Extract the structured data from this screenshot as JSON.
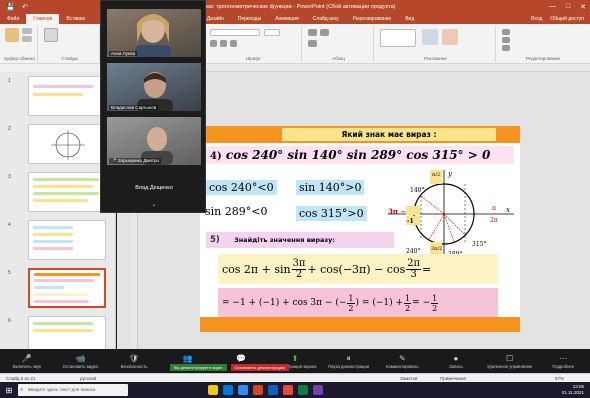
{
  "window": {
    "title": "Тема: тригонометрические функции - PowerPoint (Сбой активации продукта)",
    "controls": [
      "—",
      "□",
      "✕"
    ]
  },
  "ribbon": {
    "tabs": [
      "Файл",
      "Главная",
      "Вставка",
      "Дизайн",
      "Переходы",
      "Анимация",
      "Слайд-шоу",
      "Рецензирование",
      "Вид",
      "Справка"
    ],
    "active_tab": "Главная",
    "right_tools": [
      "Вход",
      "Общий доступ"
    ],
    "groups": [
      "Буфер обмена",
      "Слайды",
      "Шрифт",
      "Абзац",
      "Рисование",
      "Редактирование"
    ]
  },
  "thumbnails": [
    {
      "num": "1"
    },
    {
      "num": "2"
    },
    {
      "num": "3"
    },
    {
      "num": "4"
    },
    {
      "num": "5"
    },
    {
      "num": "6"
    }
  ],
  "zoom": {
    "participants": [
      {
        "name": "Анна Луева",
        "mic": ""
      },
      {
        "name": "Владислав Сартынов",
        "mic": ""
      },
      {
        "name": "Зорыщенко Дмитро",
        "mic": "🎤"
      }
    ],
    "placeholder": "Влад Дещенко",
    "chevron": "⌄",
    "toolbar": [
      {
        "icon": "🎤",
        "label": "Включить звук"
      },
      {
        "icon": "📹",
        "label": "Остановить видео"
      },
      {
        "icon": "🛡",
        "label": "Безопасность"
      },
      {
        "icon": "👥",
        "label": "Участники"
      },
      {
        "icon": "💬",
        "label": "Чат"
      },
      {
        "icon": "⬆",
        "label": "Демонстрация экрана"
      },
      {
        "icon": "⏸",
        "label": "Пауза демонстрации"
      },
      {
        "icon": "✎",
        "label": "Комментировать"
      },
      {
        "icon": "●",
        "label": "Запись"
      },
      {
        "icon": "☐",
        "label": "Удаленное управление"
      },
      {
        "icon": "⋯",
        "label": "Подробнее"
      }
    ],
    "notice_share": "Вы демонстрируете экран",
    "notice_stop": "Остановить демонстрацию"
  },
  "slide": {
    "header": "Який знак має вираз :",
    "task4": {
      "num": "4)",
      "expr": "cos 240° sin 140° sin 289° cos 315° > 0"
    },
    "ineqs": [
      "cos 240°<0",
      "sin 140°>0",
      "sin 289°<0",
      "cos 315°>0"
    ],
    "task5": {
      "num": "5)",
      "text": "Знайдіть значення виразу:"
    },
    "formula1": {
      "a": "cos 2π + sin",
      "frac1_num": "3π",
      "frac1_den": "2",
      "b": "+ cos(−3π) − cos",
      "frac2_num": "2π",
      "frac2_den": "3",
      "c": "="
    },
    "formula2": {
      "a": "= −1 + (−1) + cos 3π − (−",
      "h_num": "1",
      "h_den": "2",
      "b": ") = (−1) +",
      "h2_num": "1",
      "h2_den": "2",
      "c": "= −",
      "h3_num": "1",
      "h3_den": "2"
    },
    "circle_labels": {
      "pi2": "π/2",
      "y": "y",
      "x": "x",
      "a140": "140°",
      "a240": "240°",
      "a289": "289°",
      "a315": "315°",
      "pi": "3π −",
      "m1": "-1",
      "three_pi_2": "3π/2",
      "pi_a": "π",
      "pi_b": "2π"
    }
  },
  "statusbar": {
    "slide_of": "Слайд 5 из 21",
    "lang": "русский",
    "notes": "Заметки",
    "comments": "Примечания",
    "zoom": "67%"
  },
  "taskbar": {
    "search_placeholder": "Введите здесь текст для поиска",
    "time": "13:05",
    "date": "01.11.2021"
  },
  "colors": {
    "ppt_accent": "#b7472a",
    "slide_orange": "#f7941d",
    "zoom_green": "#2ecc40"
  }
}
